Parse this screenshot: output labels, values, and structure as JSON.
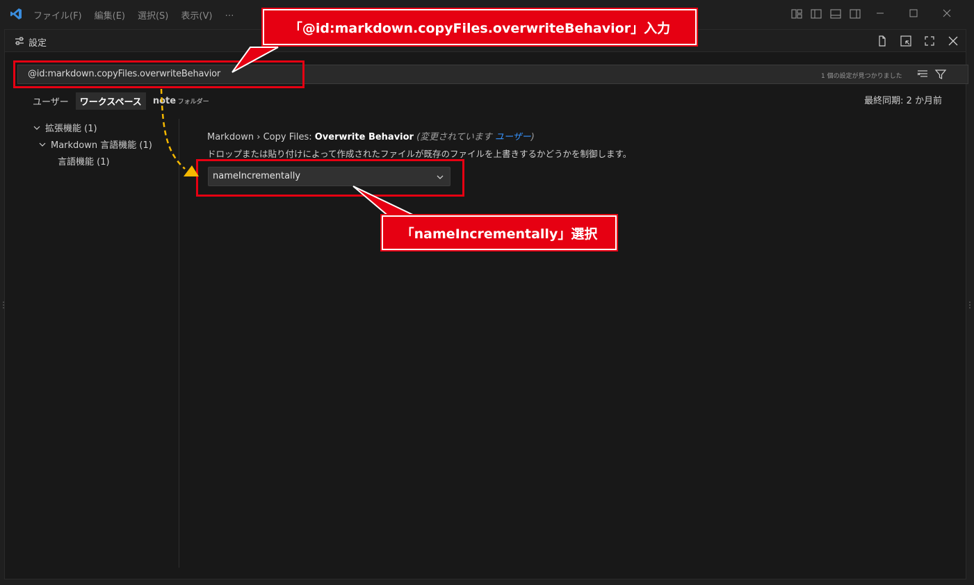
{
  "titlebar": {
    "menu": [
      "ファイル(F)",
      "編集(E)",
      "選択(S)",
      "表示(V)",
      "…"
    ]
  },
  "tab": {
    "title": "設定"
  },
  "search": {
    "value": "@id:markdown.copyFiles.overwriteBehavior",
    "result_count": "1 個の設定が見つかりました"
  },
  "scopes": {
    "user": "ユーザー",
    "workspace": "ワークスペース",
    "folder_name": "note",
    "folder_label": "フォルダー"
  },
  "sync": "最終同期: 2 か月前",
  "toc": {
    "extensions": "拡張機能 (1)",
    "markdown_lang": "Markdown 言語機能 (1)",
    "lang_features": "言語機能 (1)"
  },
  "setting": {
    "category": "Markdown › Copy Files: ",
    "name": "Overwrite Behavior",
    "modified_prefix": "(変更されています ",
    "modified_link": "ユーザー",
    "modified_suffix": ")",
    "description": "ドロップまたは貼り付けによって作成されたファイルが既存のファイルを上書きするかどうかを制御します。",
    "value": "nameIncrementally"
  },
  "annotations": {
    "callout_search": "「@id:markdown.copyFiles.overwriteBehavior」入力",
    "callout_select": "「nameIncrementally」選択",
    "highlight_color": "#e60012",
    "arrow_color": "#f5b800"
  },
  "colors": {
    "accent": "#3794ff",
    "background": "#181818"
  }
}
